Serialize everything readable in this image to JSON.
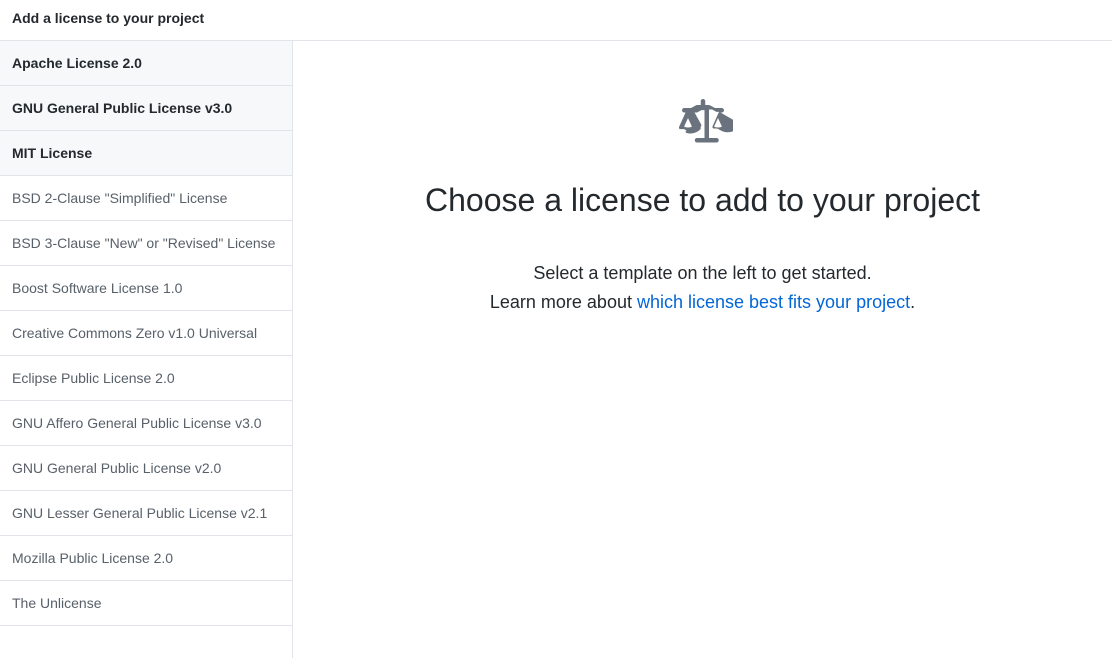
{
  "header": {
    "title": "Add a license to your project"
  },
  "sidebar": {
    "licenses": [
      {
        "label": "Apache License 2.0",
        "featured": true
      },
      {
        "label": "GNU General Public License v3.0",
        "featured": true
      },
      {
        "label": "MIT License",
        "featured": true
      },
      {
        "label": "BSD 2-Clause \"Simplified\" License",
        "featured": false
      },
      {
        "label": "BSD 3-Clause \"New\" or \"Revised\" License",
        "featured": false
      },
      {
        "label": "Boost Software License 1.0",
        "featured": false
      },
      {
        "label": "Creative Commons Zero v1.0 Universal",
        "featured": false
      },
      {
        "label": "Eclipse Public License 2.0",
        "featured": false
      },
      {
        "label": "GNU Affero General Public License v3.0",
        "featured": false
      },
      {
        "label": "GNU General Public License v2.0",
        "featured": false
      },
      {
        "label": "GNU Lesser General Public License v2.1",
        "featured": false
      },
      {
        "label": "Mozilla Public License 2.0",
        "featured": false
      },
      {
        "label": "The Unlicense",
        "featured": false
      }
    ]
  },
  "main": {
    "heading": "Choose a license to add to your project",
    "line1": "Select a template on the left to get started.",
    "line2_prefix": "Learn more about ",
    "line2_link": "which license best fits your project",
    "line2_suffix": "."
  }
}
